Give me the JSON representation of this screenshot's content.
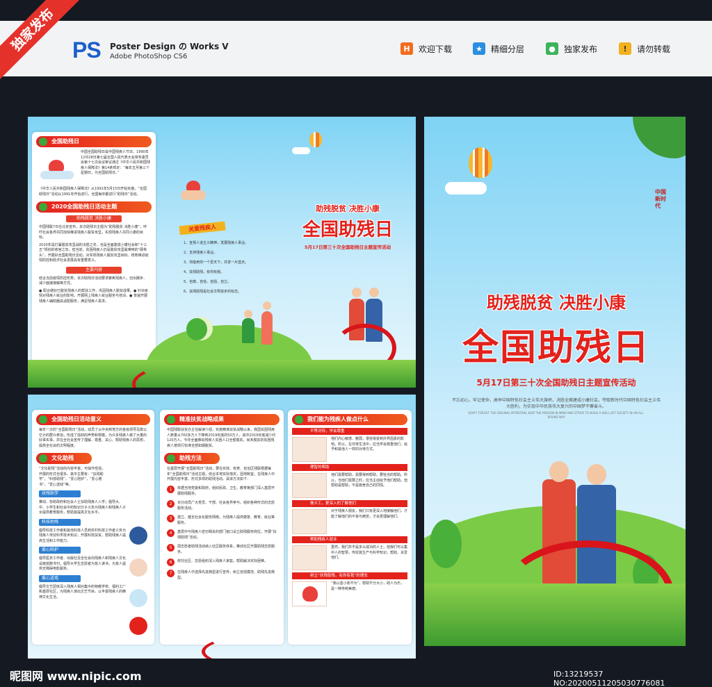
{
  "corner_label": "独家发布",
  "header": {
    "logo": "PS",
    "title": "Poster Design の Works V",
    "subtitle": "Adobe PhotoShop CS6",
    "items": [
      {
        "label": "欢迎下载",
        "icon": "H",
        "color": "#f26c1e"
      },
      {
        "label": "精细分层",
        "icon": "★",
        "color": "#2a8fe0"
      },
      {
        "label": "独家发布",
        "icon": "●",
        "color": "#3db35b"
      },
      {
        "label": "请勿转载",
        "icon": "!",
        "color": "#f2b21e"
      }
    ]
  },
  "p1": {
    "s1_title": "全国助残日",
    "s1_text": "中国全国助残日是中国残疾人节日。1990年12月28日第七届全国人民代表大会常务委员会第十七次会议审议通过《中华人民共和国残疾人保障法》第14条规定：“每年五月第三个星期日，为全国助残日。”",
    "s1_text2": "《中华人民共和国残疾人保障法》从1991年5月15日开始实施，“全国助残日”活动从1991年开始进行，全国每年都进行“助残日”活动。",
    "s2_title": "2020全国助残日活动主题",
    "s2_sub": "助残脱贫 决胜小康",
    "s2_text": "中国残联7日在北京宣布，本次助残日主题为“助残脱贫 决胜小康”，呼吁社会各界共同加快推进残疾人脱贫攻坚，实现残疾人共同小康的目标。",
    "s2_text2": "2020年是打赢脱贫攻坚战的决胜之年，也是全面建成小康社会和“十三五”规划的收官之年。但当前，贫困残疾人仍是脱贫攻坚最难啃的“硬骨头”，开展好全国助残日活动，对实现残疾人脱贫攻坚目标、统筹推进疫情防控和经济社会发展具有重要意义。",
    "s3_sub": "主要内容",
    "s3_text": "结合当前疫情防控形势，本次助残日活动要求聚焦残疾人，迈出脚步、减少面接接触等方式。",
    "s3_text2": "● 配合做好已脱贫残疾人的帮扶工作，巩固残疾人脱贫成果。● 针对疫情对残疾人就业的影响，开展网上残疾人就业服务与培训。● 普遍开展残疾人辅助器具适配服务，满足残疾人需求。"
  },
  "p2": {
    "tag": "关爱残疾人",
    "items": [
      "1、宣扬人道主义精神，发展残疾人事业。",
      "2、支持残疾人事业。",
      "3、你能用你一个爱天下，共享一片蓝天。",
      "4、扶残助残，有你有我。",
      "5、自尊、自信、自强、自立。",
      "6、扶残助残是社会文明进步的标志。"
    ]
  },
  "p3": {
    "slogan": "助残脱贫 决胜小康",
    "title": "全国助残日",
    "subtitle": "5月17日第三十次全国助残日主题宣传活动"
  },
  "front": {
    "slogan": "助残脱贫 决胜小康",
    "title": "全国助残日",
    "subtitle": "5月17日第三十次全国助残日主题宣传活动",
    "body": "不忘初心，牢记使命，高举中国特色社会主义伟大旗帜，决胜全面建成小康社会，夺取新时代中国特色社会主义伟大胜利，为实现中华民族伟大复兴的中国梦不懈奋斗。",
    "body_en": "DON'T FORGET THE ORIGINAL INTENTION, KEEP THE MISSION IN MIND AND STRIVE TO BUILD A WELL-OFF SOCIETY IN AN ALL-ROUND WAY",
    "badge": "中国新时代"
  },
  "p4": {
    "s1_title": "全国助残日活动意义",
    "s1_text": "每年一次的“全国助残日”活动，动员了从中央到地方的各级领导及数以亿计的群众参加，形成了强劲的声势和规模，为众多残疾人做了大量的好事实事，并在全社会宣传了理解、尊重、关心、帮助残疾人的思想，提高全社会的文明程度。",
    "s2_title": "文化助残",
    "s2_text": "“文化助残”活动的内容丰富，可操作性强，开展的形式也很多。其中主要有：“扶残助学”，“科技助残”，“爱心陪护”，“爱心赠书”，“爱心送戏”等。",
    "subs": [
      {
        "label": "扶残助学",
        "text": "推动、协助政府和社会人士扶助残疾人入学；倡导大、中、小学生和社会中的知识分子义务为残疾人和残疾人子女提供教育服务，帮助其提高文化水平。"
      },
      {
        "label": "科技助残",
        "text": "倡导科技工作者和其他科技人员到农村科技工作者义务为残疾人传授科学技术知识，开展科技扶贫，帮助残疾人提高生活和工作能力。"
      },
      {
        "label": "爱心陪护",
        "text": "倡导医务工作者、出版社及全社会向残疾人和残疾人文化设施捐赠书刊，倡导大学生志愿者为盲人读书，为盲人提供无障碍电影服务。"
      },
      {
        "label": "爱心送戏",
        "text": "倡导文艺团体深入残疾人相对集中的特教学校、福利工厂和基层社区，为残疾人演出文艺节目，以丰富残疾人的精神文化生活。"
      }
    ]
  },
  "p5": {
    "s1_title": "精准扶贫战略成果",
    "s1_text": "中国残联扶贫办主任解读介绍，实施精准扶贫战略以来，我国贫困残疾人数量从700多万人下降到2019年底的50万人，其中2019年底减少约120万人。今年全面推动残疾人贫困人口全部脱贫，尚未脱贫的贫困残疾人按现行标准全部如期脱贫。",
    "s2_title": "助残方法",
    "s2_text": "在基层开展“全国助残日”活动，要在实效、有奇、自治区残联根据每年“全国助残日”活动主题，结合本地实际落实，因地制宜，在残疾人中开展内容丰富、形式多样的助残活动。具体方法如下：",
    "steps": [
      "依据当地党委和政府，组织民政、卫生、教育等部门深入基层开展助残服务。",
      "充分动员广大党员、干部、社会各界参与，组织各种形式的志愿服务活动。",
      "建立、健全社会化服务网络，为残疾人提供康复、教育、就业等服务。",
      "基层中与残疾人密切相关的部门窗口设立助残服务岗位，开展“扶残助残”活动。",
      "把志愿者助残活动纳入社区服务体系，推动社区开展助残志愿服务。",
      "依托社区、志愿组织深入残疾人家庭，帮助解决实际困难。",
      "在残疾人中选择先进典型进行宣传，树立自强模范、助残先进典型。"
    ]
  },
  "p6": {
    "s1_title": "我们能为残疾人做点什么",
    "steps": [
      {
        "label": "平等对待，学会尊重",
        "text": "他们内心敏感、脆弱，很容易受到外界因素的影响。所以，在日常生活中，应当学会尊重他们，给予和其他人一样的对待方式。"
      },
      {
        "label": "理智的帮助",
        "text": "他们需要帮助，需要得到帮助，要恰当的帮助。所以，当他们需要之时，应当主动给予他们帮助。但帮助是帮助，不是施舍自己的同情。"
      },
      {
        "label": "做义工，更深入的了解他们",
        "text": "对于残疾人朋友，我们只有更深入地接触他们，才能了解他们的不易与痛苦，才会更理解他们。"
      },
      {
        "label": "帮助残疾人就业",
        "text": "虽然，我们并不是多么成功的人士，但我们可以集中人的智慧，传授其生产与科学知识，帮助、关爱他们。"
      },
      {
        "label": "树立“扶残助残，有你有我”的理念",
        "text": "“我以善小而不为”，帮助不分大小，助人为乐，是一种传统美德。"
      }
    ]
  },
  "footer": {
    "watermark": "昵图网 www.nipic.com",
    "id": "ID:13219537 NO:20200511205030776081"
  }
}
